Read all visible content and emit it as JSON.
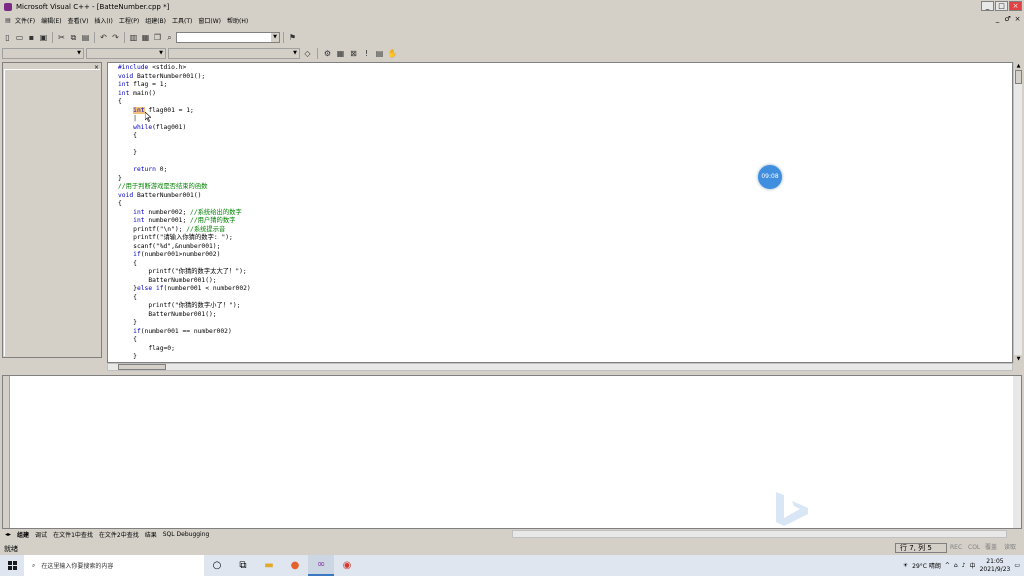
{
  "title": "Microsoft Visual C++ - [BatteNumber.cpp *]",
  "window_buttons": [
    "_",
    "□",
    "×"
  ],
  "mdi_buttons": [
    "_",
    "♂",
    "×"
  ],
  "menu": [
    "文件(F)",
    "编辑(E)",
    "查看(V)",
    "插入(I)",
    "工程(P)",
    "组建(B)",
    "工具(T)",
    "窗口(W)",
    "帮助(H)"
  ],
  "code_lines": [
    "#include <stdio.h>",
    "void BatterNumber001();",
    "int flag = 1;",
    "int main()",
    "{",
    "    int flag001 = 1;",
    "    |",
    "    while(flag001)",
    "    {",
    "",
    "    }",
    "",
    "    return 0;",
    "}",
    "//用于判断游戏是否结束的函数",
    "void BatterNumber001()",
    "{",
    "    int number002; //系统给出的数字",
    "    int number001; //用户猜的数字",
    "    printf(\"\\n\"); //系统提示音",
    "    printf(\"请输入你猜的数字: \");",
    "    scanf(\"%d\",&number001);",
    "    if(number001>number002)",
    "    {",
    "        printf(\"你猜的数字太大了！\");",
    "        BatterNumber001();",
    "    }else if(number001 < number002)",
    "    {",
    "        printf(\"你猜的数字小了！\");",
    "        BatterNumber001();",
    "    }",
    "    if(number001 == number002)",
    "    {",
    "        flag=0;",
    "    }"
  ],
  "recording_timer": "09:08",
  "output_tabs": [
    "组建",
    "调试",
    "在文件1中查找",
    "在文件2中查找",
    "结果",
    "SQL Debugging"
  ],
  "status": {
    "ready": "就绪",
    "position": "行 7, 列 5",
    "indicators": [
      "REC",
      "COL",
      "覆盖",
      "读取"
    ]
  },
  "taskbar": {
    "search_placeholder": "在这里输入你要搜索的内容",
    "weather": "29°C 晴朗",
    "ime": "中",
    "time": "21:05",
    "date": "2021/9/23"
  }
}
